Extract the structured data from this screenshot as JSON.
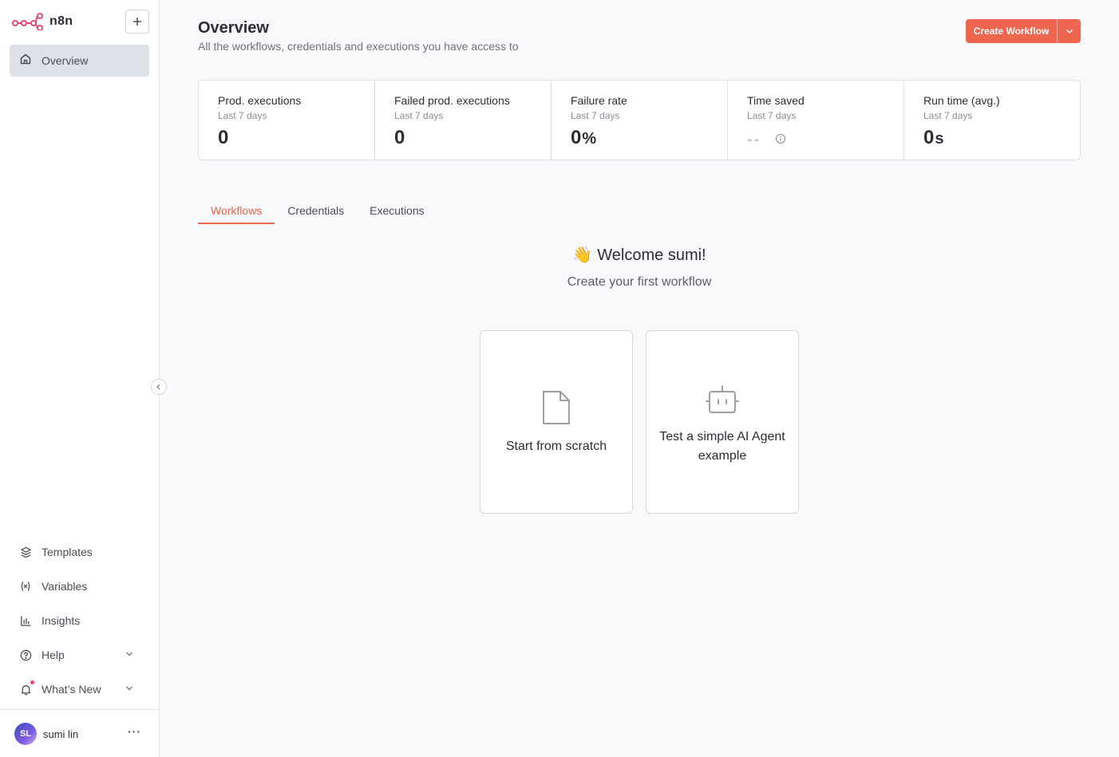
{
  "app": {
    "name": "n8n"
  },
  "sidebar": {
    "new_button_icon": "plus-icon",
    "overview": {
      "label": "Overview",
      "icon": "home-icon"
    },
    "bottom_items": [
      {
        "label": "Templates",
        "icon": "box-icon"
      },
      {
        "label": "Variables",
        "icon": "variable-icon"
      },
      {
        "label": "Insights",
        "icon": "chart-icon"
      },
      {
        "label": "Help",
        "icon": "help-circle-icon"
      },
      {
        "label": "What’s New",
        "icon": "bell-icon"
      }
    ],
    "user": {
      "initials": "SL",
      "name": "sumi lin",
      "menu": "···"
    }
  },
  "header": {
    "title": "Overview",
    "subtitle": "All the workflows, credentials and executions you have access to",
    "create_button": "Create Workflow"
  },
  "stats": [
    {
      "title": "Prod. executions",
      "period": "Last 7 days",
      "value": "0"
    },
    {
      "title": "Failed prod. executions",
      "period": "Last 7 days",
      "value": "0"
    },
    {
      "title": "Failure rate",
      "period": "Last 7 days",
      "value": "0",
      "unit": "%"
    },
    {
      "title": "Time saved",
      "period": "Last 7 days",
      "value": "--"
    },
    {
      "title": "Run time (avg.)",
      "period": "Last 7 days",
      "value": "0",
      "unit": "s"
    }
  ],
  "tabs": [
    {
      "label": "Workflows",
      "active": true
    },
    {
      "label": "Credentials",
      "active": false
    },
    {
      "label": "Executions",
      "active": false
    }
  ],
  "welcome": {
    "emoji": "👋",
    "title": "Welcome sumi!",
    "subtitle": "Create your first workflow"
  },
  "cards": [
    {
      "label": "Start from scratch",
      "icon": "file-icon"
    },
    {
      "label": "Test a simple AI Agent example",
      "icon": "robot-icon"
    }
  ],
  "colors": {
    "accent": "#ee6650",
    "brand": "#ea4b71",
    "nav_active_bg": "#dfe1e8",
    "background": "#f8f9fb"
  }
}
